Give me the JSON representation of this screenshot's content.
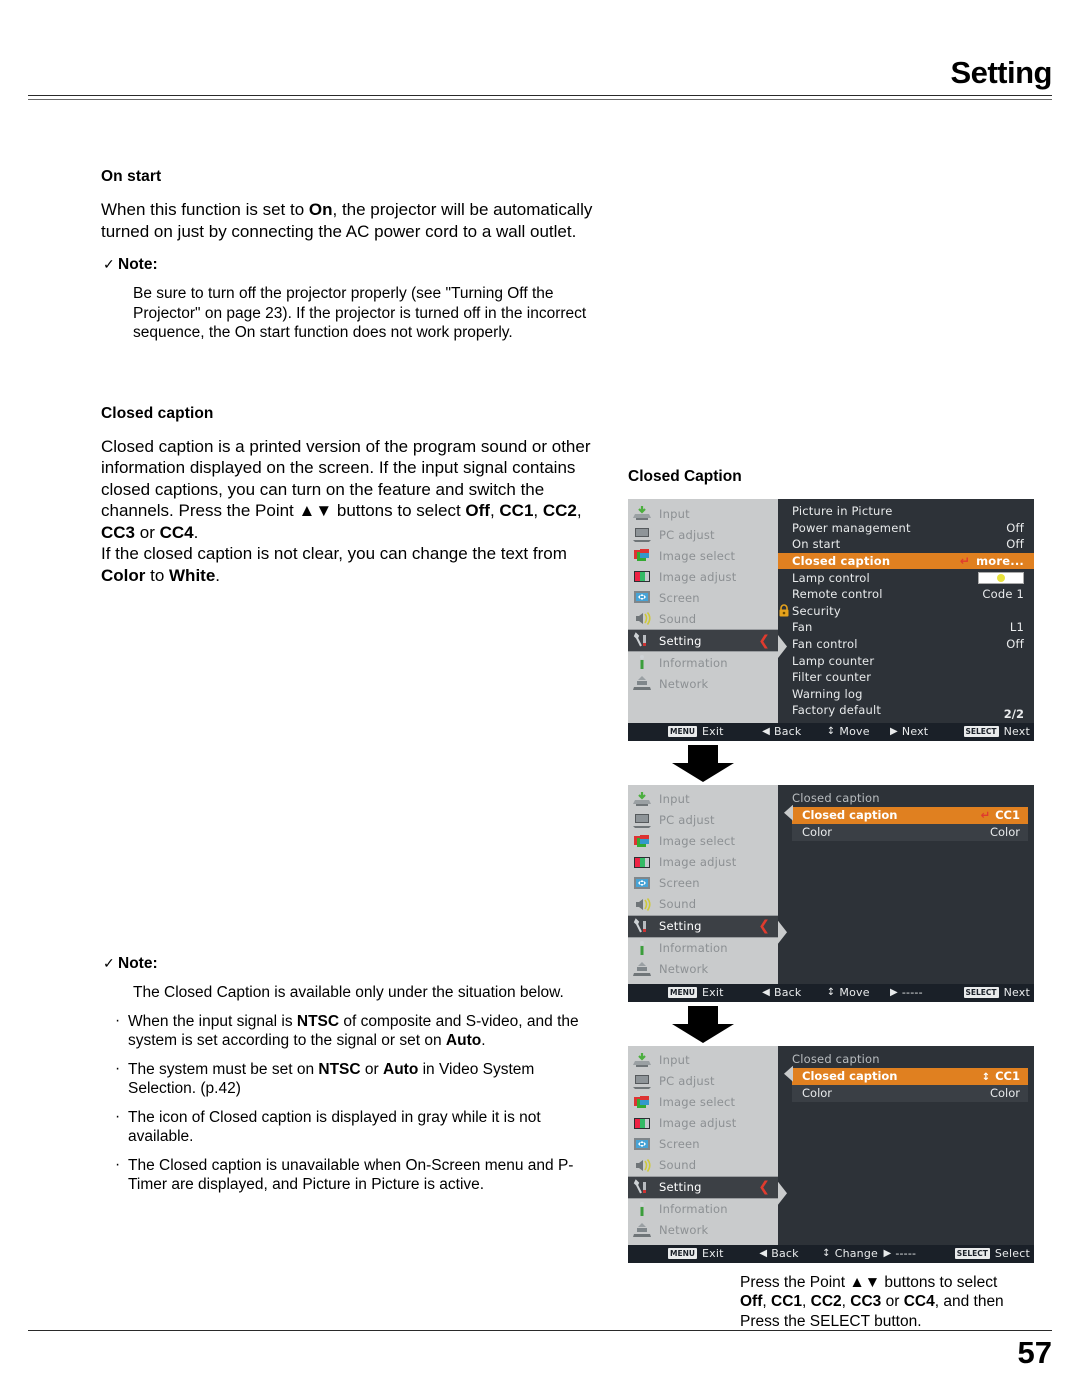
{
  "header": {
    "title": "Setting"
  },
  "footer": {
    "page_number": "57"
  },
  "left_column": {
    "on_start": {
      "heading": "On start",
      "paragraph_1": "When this function is set to ",
      "paragraph_1_bold": "On",
      "paragraph_1_rest": ", the projector will be automatically turned on just by connecting the AC power cord to a wall outlet.",
      "note_label": "Note:",
      "note_tick": "✓",
      "note_text": "Be sure to turn off the projector properly (see \"Turning Off the Projector\" on page 23). If the projector is turned off in the incorrect sequence, the On start function does not work properly."
    },
    "closed_caption": {
      "heading": "Closed caption",
      "para_a": "Closed caption is a printed version of the program sound or other information displayed on the screen. If the input signal contains closed captions, you can turn on the feature and switch the channels. Press the Point ▲▼ buttons to select ",
      "options_bold": "Off",
      "opt2": "CC1",
      "opt3": "CC2",
      "opt4": "CC3",
      "opt_or": " or ",
      "opt5": "CC4",
      "opt_end": ".",
      "para_b": "If the closed caption is not clear, you can change the text from ",
      "para_b_bold1": "Color",
      "para_b_mid": " to ",
      "para_b_bold2": "White",
      "para_b_end": "."
    },
    "note2": {
      "tick": "✓",
      "label": "Note:",
      "intro": "The Closed Caption is available only under the situation below.",
      "bullets": [
        {
          "pre": "When the input signal is ",
          "b1": "NTSC",
          "mid": " of composite and S-video, and the system is set according to the signal or set on ",
          "b2": "Auto",
          "post": "."
        },
        {
          "pre": "The system must be set on ",
          "b1": "NTSC",
          "mid": " or ",
          "b2": "Auto",
          "post": " in Video System Selection. (p.42)"
        },
        {
          "pre": "The icon of Closed caption is displayed in gray while it is not available.",
          "b1": "",
          "mid": "",
          "b2": "",
          "post": ""
        },
        {
          "pre": "The Closed caption is unavailable when On-Screen menu and P-Timer are displayed, and Picture in Picture is active.",
          "b1": "",
          "mid": "",
          "b2": "",
          "post": ""
        }
      ]
    }
  },
  "right_column": {
    "figure_title": "Closed Caption",
    "sidebar_items": [
      {
        "label": "Input",
        "icon": "input-icon"
      },
      {
        "label": "PC adjust",
        "icon": "monitor-icon"
      },
      {
        "label": "Image select",
        "icon": "image-select-icon"
      },
      {
        "label": "Image adjust",
        "icon": "image-adjust-icon"
      },
      {
        "label": "Screen",
        "icon": "screen-icon"
      },
      {
        "label": "Sound",
        "icon": "speaker-icon"
      },
      {
        "label": "Setting",
        "icon": "wrench-icon"
      },
      {
        "label": "Information",
        "icon": "info-icon"
      },
      {
        "label": "Network",
        "icon": "network-icon"
      }
    ],
    "active_sidebar": "Setting",
    "caret_glyph": "❮",
    "menu1": {
      "rows": [
        {
          "name": "Picture in Picture",
          "value": ""
        },
        {
          "name": "Power management",
          "value": "Off"
        },
        {
          "name": "On start",
          "value": "Off"
        },
        {
          "name": "Closed caption",
          "value": "more...",
          "highlight": true,
          "enter": "↵"
        },
        {
          "name": "Lamp control",
          "value": "",
          "lamp": true
        },
        {
          "name": "Remote control",
          "value": "Code 1"
        },
        {
          "name": "Security",
          "value": "",
          "lock": true
        },
        {
          "name": "Fan",
          "value": "L1"
        },
        {
          "name": "Fan control",
          "value": "Off"
        },
        {
          "name": "Lamp counter",
          "value": ""
        },
        {
          "name": "Filter counter",
          "value": ""
        },
        {
          "name": "Warning log",
          "value": ""
        },
        {
          "name": "Factory default",
          "value": ""
        }
      ],
      "page_count": "2/2",
      "bar": [
        {
          "key": "MENU",
          "label": "Exit"
        },
        {
          "glyph": "◀",
          "label": "Back"
        },
        {
          "glyph": "↕",
          "label": "Move"
        },
        {
          "glyph": "▶",
          "label": "Next"
        },
        {
          "key": "SELECT",
          "label": "Next"
        }
      ]
    },
    "menu2": {
      "panel_title": "Closed caption",
      "rows": [
        {
          "name": "Closed caption",
          "value": "CC1",
          "highlight": true,
          "enter": "↵"
        },
        {
          "name": "Color",
          "value": "Color"
        }
      ],
      "bar": [
        {
          "key": "MENU",
          "label": "Exit"
        },
        {
          "glyph": "◀",
          "label": "Back"
        },
        {
          "glyph": "↕",
          "label": "Move"
        },
        {
          "glyph": "▶",
          "label": "-----"
        },
        {
          "key": "SELECT",
          "label": "Next"
        }
      ]
    },
    "menu3": {
      "panel_title": "Closed caption",
      "rows": [
        {
          "name": "Closed caption",
          "value": "CC1",
          "highlight": true,
          "updown": "↕"
        },
        {
          "name": "Color",
          "value": "Color"
        }
      ],
      "bar": [
        {
          "key": "MENU",
          "label": "Exit"
        },
        {
          "glyph": "◀",
          "label": "Back"
        },
        {
          "glyph": "↕",
          "label": "Change"
        },
        {
          "glyph": "▶",
          "label": "-----"
        },
        {
          "key": "SELECT",
          "label": "Select"
        }
      ]
    },
    "caption": {
      "line1": "Press the Point ▲▼ buttons to select",
      "line2_b1": "Off",
      "line2_b2": "CC1",
      "line2_b3": "CC2",
      "line2_b4": "CC3",
      "line2_or": " or ",
      "line2_b5": "CC4",
      "line2_end": ", and then",
      "line3": "Press the SELECT button."
    }
  },
  "colors": {
    "highlight": "#E08020",
    "osd_dark": "#2D3238",
    "osd_sidebar": "#C9CBCC",
    "osd_bar": "#1A2028",
    "caret_red": "#E03B2E"
  }
}
